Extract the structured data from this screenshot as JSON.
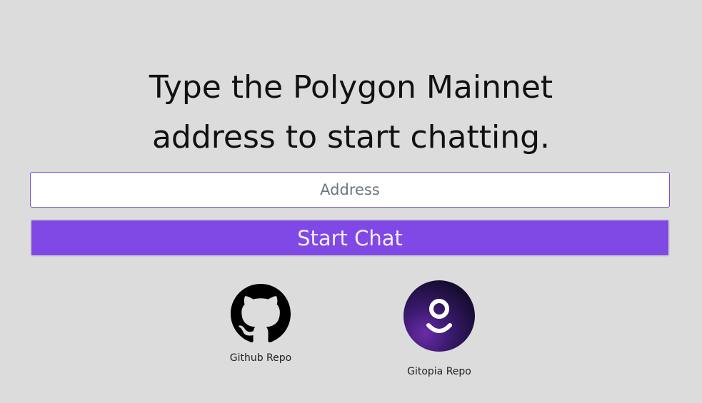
{
  "heading": {
    "line1": "Type the Polygon Mainnet",
    "line2": "address to start chatting."
  },
  "address_input": {
    "value": "",
    "placeholder": "Address"
  },
  "start_button": {
    "label": "Start Chat"
  },
  "links": {
    "github": {
      "label": "Github Repo",
      "icon": "github-icon"
    },
    "gitopia": {
      "label": "Gitopia Repo",
      "icon": "gitopia-icon"
    }
  },
  "colors": {
    "background": "#dcdcdc",
    "accent": "#8048e4",
    "input_border": "#7b4fd0"
  }
}
